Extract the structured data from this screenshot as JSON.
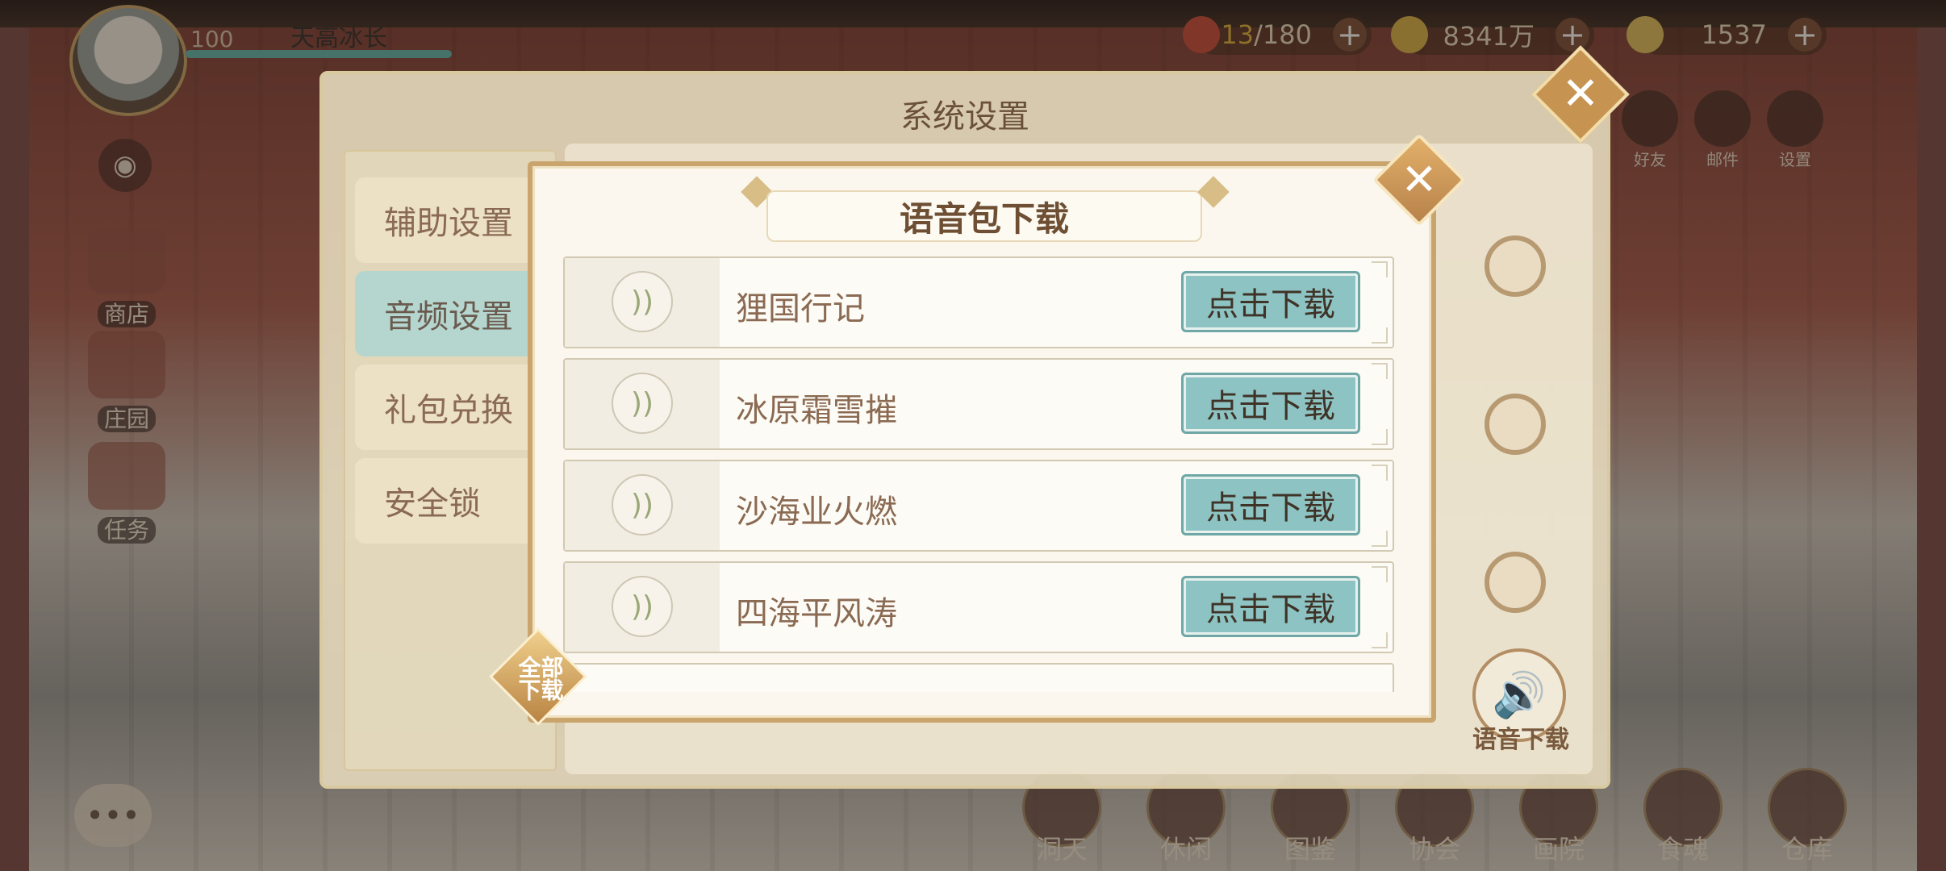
{
  "player": {
    "level": "100",
    "name": "天高冰长"
  },
  "currencies": [
    {
      "icon": "stamina-icon",
      "current": "13",
      "max": "/180"
    },
    {
      "icon": "coin-icon",
      "value": "8341万"
    },
    {
      "icon": "gem-icon",
      "value": "1537"
    }
  ],
  "side_menu": [
    {
      "label": "商店",
      "icon": "shop-icon"
    },
    {
      "label": "庄园",
      "icon": "manor-icon"
    },
    {
      "label": "任务",
      "icon": "task-icon"
    }
  ],
  "top_right_icons": [
    {
      "label": "好友",
      "icon": "friends-icon"
    },
    {
      "label": "邮件",
      "icon": "mail-icon"
    },
    {
      "label": "设置",
      "icon": "gear-icon"
    }
  ],
  "bottom_nav": [
    {
      "label": "洞天"
    },
    {
      "label": "休闲"
    },
    {
      "label": "图鉴"
    },
    {
      "label": "协会"
    },
    {
      "label": "画院"
    },
    {
      "label": "食魂"
    },
    {
      "label": "仓库"
    }
  ],
  "settings": {
    "title": "系统设置",
    "tabs": [
      {
        "label": "辅助设置",
        "active": false
      },
      {
        "label": "音频设置",
        "active": true
      },
      {
        "label": "礼包兑换",
        "active": false
      },
      {
        "label": "安全锁",
        "active": false
      }
    ],
    "voice_download_label": "语音下载"
  },
  "dialog": {
    "title": "语音包下载",
    "close_glyph": "✕",
    "all_download_label": "全部下载",
    "packs": [
      {
        "name": "狸国行记",
        "button": "点击下载"
      },
      {
        "name": "冰原霜雪摧",
        "button": "点击下载"
      },
      {
        "name": "沙海业火燃",
        "button": "点击下载"
      },
      {
        "name": "四海平风涛",
        "button": "点击下载"
      }
    ]
  },
  "colors": {
    "download_button": "#8ec3c3",
    "frame_gold": "#c9a46d",
    "text_brown": "#8a6a52"
  }
}
